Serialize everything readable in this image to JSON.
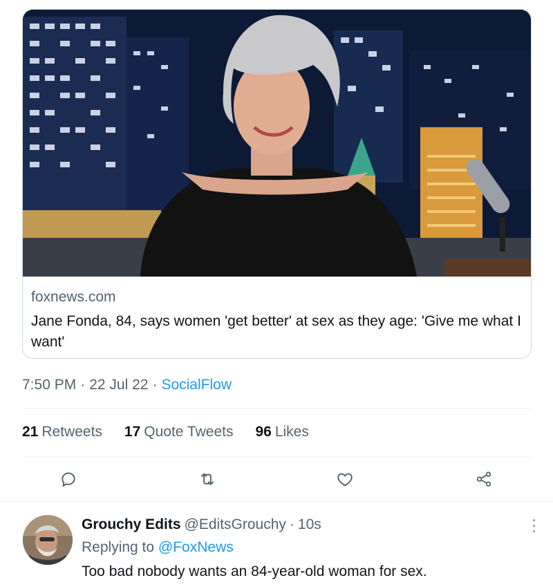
{
  "card": {
    "image_alt": "Jane Fonda on talk show set",
    "domain": "foxnews.com",
    "title": "Jane Fonda, 84, says women 'get better' at sex as they age: 'Give me what I want'"
  },
  "meta": {
    "time": "7:50 PM",
    "separator": "·",
    "date": "22 Jul 22",
    "source": "SocialFlow"
  },
  "stats": [
    {
      "count": "21",
      "label": "Retweets"
    },
    {
      "count": "17",
      "label": "Quote Tweets"
    },
    {
      "count": "96",
      "label": "Likes"
    }
  ],
  "actions": {
    "icons": [
      "reply-icon",
      "retweet-icon",
      "like-icon",
      "share-icon"
    ],
    "color": "#536471"
  },
  "reply": {
    "name": "Grouchy Edits",
    "handle": "@EditsGrouchy",
    "separator": "·",
    "time": "10s",
    "replying_prefix": "Replying to",
    "replying_handle": "@FoxNews",
    "text": "Too bad nobody wants an 84-year-old woman for sex."
  },
  "colors": {
    "accent": "#1d9bf0",
    "secondary_text": "#536471",
    "primary_text": "#0f1419",
    "border": "#cfd9de"
  }
}
